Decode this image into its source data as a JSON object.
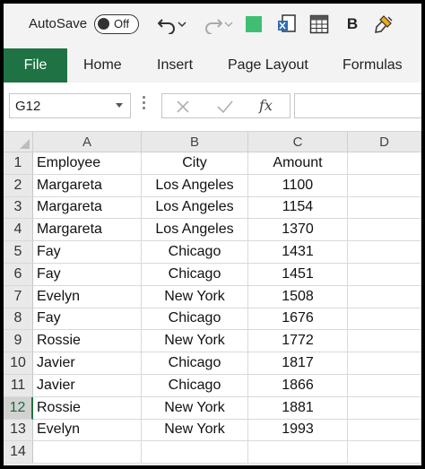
{
  "qat": {
    "autosave_label": "AutoSave",
    "toggle_state": "Off"
  },
  "ribbon": {
    "tabs": [
      "File",
      "Home",
      "Insert",
      "Page Layout",
      "Formulas"
    ]
  },
  "formula_bar": {
    "name_box": "G12",
    "fx": "fx",
    "value": ""
  },
  "columns": [
    "A",
    "B",
    "C",
    "D"
  ],
  "rows": [
    {
      "n": "1",
      "cells": [
        "Employee",
        "City",
        "Amount",
        ""
      ]
    },
    {
      "n": "2",
      "cells": [
        "Margareta",
        "Los Angeles",
        "1100",
        ""
      ]
    },
    {
      "n": "3",
      "cells": [
        "Margareta",
        "Los Angeles",
        "1154",
        ""
      ]
    },
    {
      "n": "4",
      "cells": [
        "Margareta",
        "Los Angeles",
        "1370",
        ""
      ]
    },
    {
      "n": "5",
      "cells": [
        "Fay",
        "Chicago",
        "1431",
        ""
      ]
    },
    {
      "n": "6",
      "cells": [
        "Fay",
        "Chicago",
        "1451",
        ""
      ]
    },
    {
      "n": "7",
      "cells": [
        "Evelyn",
        "New York",
        "1508",
        ""
      ]
    },
    {
      "n": "8",
      "cells": [
        "Fay",
        "Chicago",
        "1676",
        ""
      ]
    },
    {
      "n": "9",
      "cells": [
        "Rossie",
        "New York",
        "1772",
        ""
      ]
    },
    {
      "n": "10",
      "cells": [
        "Javier",
        "Chicago",
        "1817",
        ""
      ]
    },
    {
      "n": "11",
      "cells": [
        "Javier",
        "Chicago",
        "1866",
        ""
      ]
    },
    {
      "n": "12",
      "cells": [
        "Rossie",
        "New York",
        "1881",
        ""
      ]
    },
    {
      "n": "13",
      "cells": [
        "Evelyn",
        "New York",
        "1993",
        ""
      ]
    },
    {
      "n": "14",
      "cells": [
        "",
        "",
        "",
        ""
      ]
    }
  ],
  "selected_row": "12",
  "colors": {
    "accent": "#1f7244",
    "qat_save": "#3fbf74"
  },
  "icons": [
    "undo-icon",
    "redo-icon",
    "save-icon",
    "document-icon",
    "table-icon",
    "bold-icon",
    "format-painter-icon",
    "cancel-icon",
    "enter-icon"
  ]
}
